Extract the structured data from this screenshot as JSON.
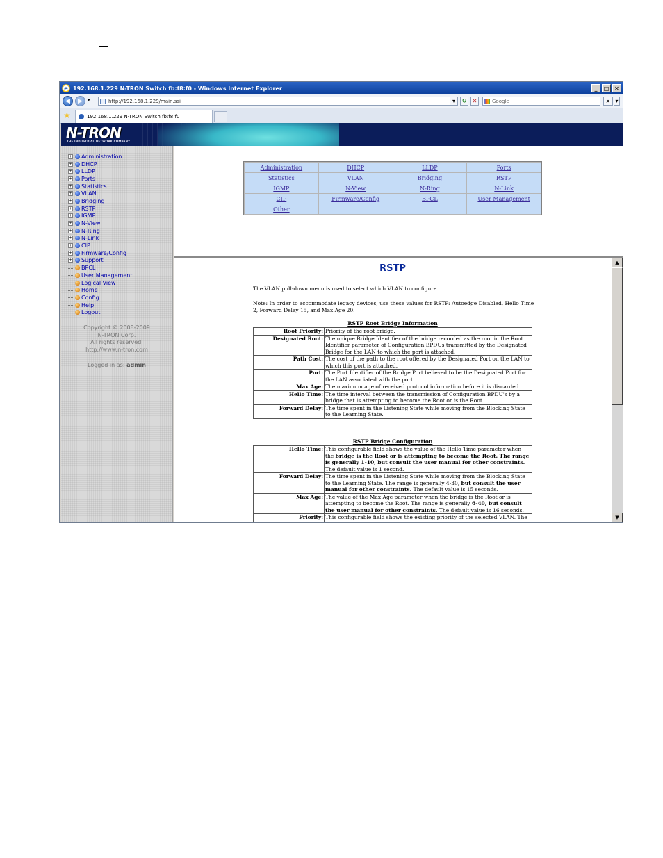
{
  "window": {
    "title": "192.168.1.229 N-TRON Switch fb:f8:f0 - Windows Internet Explorer",
    "minimize": "_",
    "maximize": "□",
    "close": "✕"
  },
  "navbar": {
    "back": "◀",
    "forward": "▶",
    "address": "http://192.168.1.229/main.ssi",
    "refresh": "↻",
    "stop": "✕",
    "search_placeholder": "Google",
    "search_go": "⌕"
  },
  "tab": {
    "label": "192.168.1.229 N-TRON Switch fb:f8:f0"
  },
  "banner": {
    "logo": "N-TRON",
    "tagline": "THE INDUSTRIAL NETWORK COMPANY"
  },
  "sidebar": {
    "items": [
      {
        "label": "Administration",
        "expandable": true,
        "color": "#0a2ca8"
      },
      {
        "label": "DHCP",
        "expandable": true,
        "color": "#0a2ca8"
      },
      {
        "label": "LLDP",
        "expandable": true,
        "color": "#0a2ca8"
      },
      {
        "label": "Ports",
        "expandable": true,
        "color": "#0a2ca8"
      },
      {
        "label": "Statistics",
        "expandable": true,
        "color": "#0a2ca8"
      },
      {
        "label": "VLAN",
        "expandable": true,
        "color": "#0a2ca8"
      },
      {
        "label": "Bridging",
        "expandable": true,
        "color": "#0a2ca8"
      },
      {
        "label": "RSTP",
        "expandable": true,
        "color": "#0a2ca8"
      },
      {
        "label": "IGMP",
        "expandable": true,
        "color": "#0a2ca8"
      },
      {
        "label": "N-View",
        "expandable": true,
        "color": "#0a2ca8"
      },
      {
        "label": "N-Ring",
        "expandable": true,
        "color": "#0a2ca8"
      },
      {
        "label": "N-Link",
        "expandable": true,
        "color": "#0a2ca8"
      },
      {
        "label": "CIP",
        "expandable": true,
        "color": "#0a2ca8"
      },
      {
        "label": "Firmware/Config",
        "expandable": true,
        "color": "#0a2ca8"
      },
      {
        "label": "Support",
        "expandable": true,
        "color": "#0a2ca8"
      },
      {
        "label": "BPCL",
        "expandable": false,
        "color": "#c86a00"
      },
      {
        "label": "User Management",
        "expandable": false,
        "color": "#c86a00"
      },
      {
        "label": "Logical View",
        "expandable": false,
        "color": "#c86a00"
      },
      {
        "label": "Home",
        "expandable": false,
        "color": "#c86a00"
      },
      {
        "label": "Config",
        "expandable": false,
        "color": "#c86a00"
      },
      {
        "label": "Help",
        "expandable": false,
        "color": "#c86a00"
      },
      {
        "label": "Logout",
        "expandable": false,
        "color": "#c86a00"
      }
    ],
    "copyright": [
      "Copyright © 2008-2009",
      "N-TRON Corp.",
      "All rights reserved.",
      "http://www.n-tron.com"
    ],
    "logged_prefix": "Logged in as:",
    "logged_user": "admin"
  },
  "topframe": {
    "links": [
      [
        "Administration",
        "DHCP",
        "LLDP",
        "Ports"
      ],
      [
        "Statistics",
        "VLAN",
        "Bridging",
        "RSTP"
      ],
      [
        "IGMP",
        "N-View",
        "N-Ring",
        "N-Link"
      ],
      [
        "CIP",
        "Firmware/Config",
        "BPCL",
        "User Management"
      ],
      [
        "Other",
        "",
        "",
        ""
      ]
    ]
  },
  "help": {
    "title": "RSTP",
    "intro": "The VLAN pull-down menu is used to select which VLAN to configure.",
    "note": "Note: In order to accommodate legacy devices, use these values for RSTP: Autoedge Disabled, Hello Time 2, Forward Delay 15, and Max Age 20.",
    "section1_title": "RSTP Root Bridge Information",
    "section1_rows": [
      {
        "label": "Root Priority:",
        "text": "Priority of the root bridge."
      },
      {
        "label": "Designated Root:",
        "text": "The unique Bridge Identifier of the bridge recorded as the root in the Root Identifier parameter of Configuration BPDUs transmitted by the Designated Bridge for the LAN to which the port is attached."
      },
      {
        "label": "Path Cost:",
        "text": "The cost of the path to the root offered by the Designated Port on the LAN to which this port is attached."
      },
      {
        "label": "Port:",
        "text": "The Port Identifier of the Bridge Port believed to be the Designated Port for the LAN associated with the port."
      },
      {
        "label": "Max Age:",
        "text": "The maximum age of received protocol information before it is discarded."
      },
      {
        "label": "Hello Time:",
        "text": "The time interval between the transmission of Configuration BPDU's by a bridge that is attempting to become the Root or is the Root."
      },
      {
        "label": "Forward Delay:",
        "text": "The time spent in the Listening State while moving from the Blocking State to the Learning State."
      }
    ],
    "section2_title": "RSTP Bridge Configuration",
    "section2_rows": [
      {
        "label": "Hello Time:",
        "text": "This configurable field shows the value of the Hello Time parameter when the ",
        "bold": "bridge is the Root or is attempting to become the Root. The range is generally 1-10, but consult the user manual for other constraints.",
        "tail": " The default value is 1 second."
      },
      {
        "label": "Forward Delay:",
        "text": "The time spent in the Listening State while moving from the Blocking State to the Learning State. The range is generally 4-30, ",
        "bold": "but consult the user manual for other constraints.",
        "tail": " The default value is 15 seconds."
      },
      {
        "label": "Max Age:",
        "text": "The value of the Max Age parameter when the bridge is the Root or is attempting to become the Root. The range is generally ",
        "bold": "6-40, but consult the user manual for other constraints.",
        "tail": " The default value is 16 seconds."
      },
      {
        "label": "Priority:",
        "text": "This configurable field shows the existing priority of the selected VLAN. The range",
        "bold": "",
        "tail": ""
      }
    ]
  },
  "scroll": {
    "up": "▲",
    "down": "▼"
  }
}
